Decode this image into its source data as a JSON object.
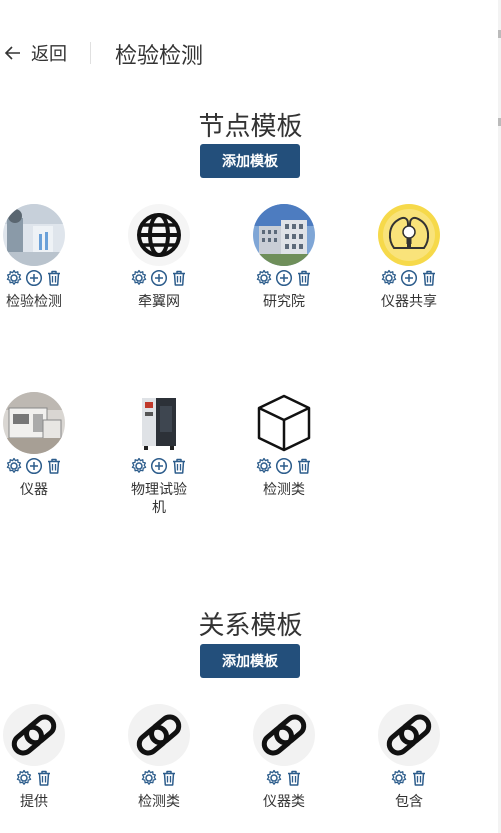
{
  "header": {
    "back_label": "返回",
    "title": "检验检测"
  },
  "node_section": {
    "title": "节点模板",
    "add_label": "添加模板",
    "items": [
      {
        "label": "检验检测",
        "icon": "lab-photo-icon"
      },
      {
        "label": "牵翼网",
        "icon": "globe-icon"
      },
      {
        "label": "研究院",
        "icon": "building-photo-icon"
      },
      {
        "label": "仪器共享",
        "icon": "lightbulb-head-icon"
      },
      {
        "label": "仪器",
        "icon": "instrument-photo-icon"
      },
      {
        "label": "物理试验机",
        "icon": "test-chamber-icon"
      },
      {
        "label": "检测类",
        "icon": "cube-icon"
      }
    ]
  },
  "relation_section": {
    "title": "关系模板",
    "add_label": "添加模板",
    "items": [
      {
        "label": "提供",
        "icon": "link-icon"
      },
      {
        "label": "检测类",
        "icon": "link-icon"
      },
      {
        "label": "仪器类",
        "icon": "link-icon"
      },
      {
        "label": "包含",
        "icon": "link-icon"
      }
    ]
  },
  "colors": {
    "accent": "#234f7b",
    "icon_blue": "#2d5d8c"
  }
}
